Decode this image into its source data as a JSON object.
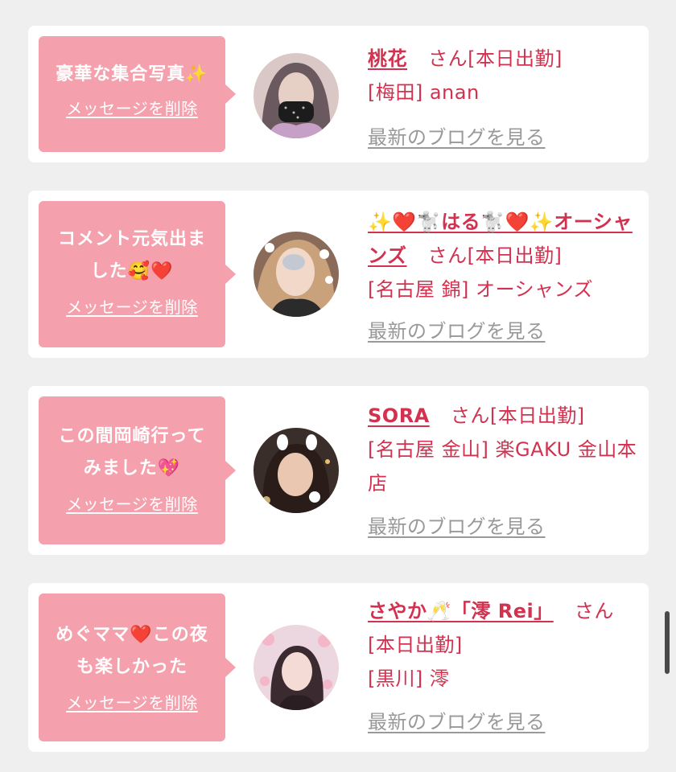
{
  "cards": [
    {
      "message": "豪華な集合写真✨",
      "delete_label": "メッセージを削除",
      "name": "桃花",
      "san_status": "さん[本日出勤]",
      "location": "[梅田] anan",
      "blog_label": "最新のブログを見る"
    },
    {
      "message": "コメント元気出ま\nした🥰❤️",
      "delete_label": "メッセージを削除",
      "name": "✨❤️🐩はる🐩❤️✨オーシャンズ",
      "san_status": "さん[本日出勤]",
      "location": "[名古屋 錦] オーシャンズ",
      "blog_label": "最新のブログを見る"
    },
    {
      "message": "この間岡崎行って\nみました💖",
      "delete_label": "メッセージを削除",
      "name": "SORA",
      "san_status": "さん[本日出勤]",
      "location": "[名古屋 金山] 楽GAKU 金山本店",
      "blog_label": "最新のブログを見る"
    },
    {
      "message": "めぐママ❤️この夜\nも楽しかった",
      "delete_label": "メッセージを削除",
      "name": "さやか🥂「澪 Rei」",
      "san_status": "さん[本日出勤]",
      "location": "[黒川] 澪",
      "blog_label": "最新のブログを見る"
    }
  ],
  "colors": {
    "bubble": "#f5a0ad",
    "accent": "#d2324f",
    "link_gray": "#999999",
    "background": "#efefef"
  }
}
